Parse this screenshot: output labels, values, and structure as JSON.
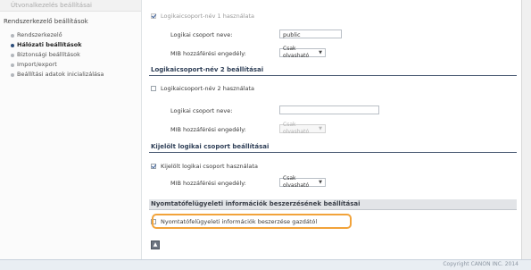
{
  "sidebar": {
    "top_item": "Útvonalkezelés beállításai",
    "section_title": "Rendszerkezelő beállítások",
    "items": [
      {
        "label": "Rendszerkezelő",
        "active": false
      },
      {
        "label": "Hálózati beállítások",
        "active": true
      },
      {
        "label": "Biztonsági beállítások",
        "active": false
      },
      {
        "label": "Import/export",
        "active": false
      },
      {
        "label": "Beállítási adatok inicializálása",
        "active": false
      }
    ]
  },
  "group1": {
    "enable_label": "Logikaicsoport-név 1 használata",
    "name_label": "Logikai csoport neve:",
    "name_value": "public",
    "access_label": "MIB hozzáférési engedély:",
    "access_value": "Csak olvasható"
  },
  "group2": {
    "section_title": "Logikaicsoport-név 2 beállításai",
    "enable_label": "Logikaicsoport-név 2 használata",
    "name_label": "Logikai csoport neve:",
    "name_value": "",
    "access_label": "MIB hozzáférési engedély:",
    "access_value": "Csak olvasható"
  },
  "dedicated": {
    "section_title": "Kijelölt logikai csoport beállításai",
    "enable_label": "Kijelölt logikai csoport használata",
    "access_label": "MIB hozzáférési engedély:",
    "access_value": "Csak olvasható"
  },
  "printer_mgmt": {
    "section_title": "Nyomtatófelügyeleti információk beszerzésének beállításai",
    "enable_label": "Nyomtatófelügyeleti információk beszerzése gazdától"
  },
  "statusbar": {
    "text": "Copyright CANON INC. 2014"
  },
  "colors": {
    "highlight": "#f2a33a",
    "section_border": "#4a5a73",
    "sidebar_active_dot": "#2c4d7a"
  }
}
